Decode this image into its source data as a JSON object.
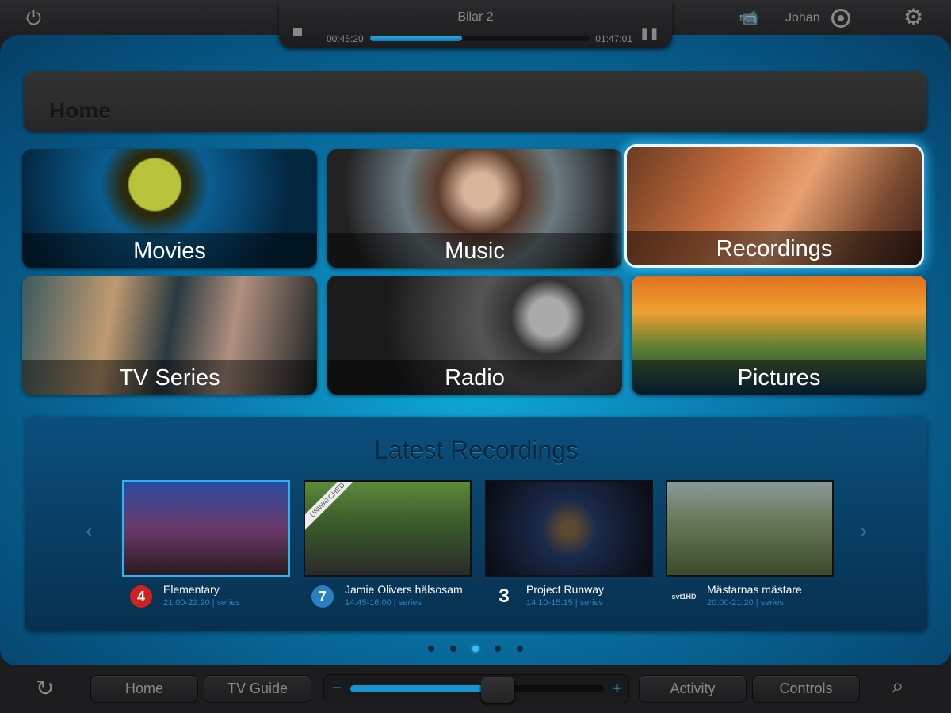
{
  "top": {
    "user": "Johan",
    "icons": [
      "power-icon",
      "camera-icon",
      "target-icon",
      "gear-icon"
    ]
  },
  "now_playing": {
    "title": "Bilar 2",
    "elapsed": "00:45:20",
    "total": "01:47:01",
    "progress_percent": 42
  },
  "header": {
    "title": "Home"
  },
  "tiles": [
    {
      "label": "Movies",
      "selected": false
    },
    {
      "label": "Music",
      "selected": false
    },
    {
      "label": "Recordings",
      "selected": true
    },
    {
      "label": "TV Series",
      "selected": false
    },
    {
      "label": "Radio",
      "selected": false
    },
    {
      "label": "Pictures",
      "selected": false
    }
  ],
  "latest": {
    "title": "Latest Recordings",
    "items": [
      {
        "title": "Elementary",
        "time": "21:00-22:20",
        "type": "series",
        "channel": "4",
        "selected": true
      },
      {
        "title": "Jamie Olivers hälsosam",
        "time": "14:45-16:00",
        "type": "series",
        "channel": "7",
        "badge": "UNWATCHED"
      },
      {
        "title": "Project Runway",
        "time": "14:10-15:15",
        "type": "series",
        "channel": "3"
      },
      {
        "title": "Mästarnas mästare",
        "time": "20:00-21:20",
        "type": "series",
        "channel": "svt1HD"
      }
    ],
    "page_count": 5,
    "active_page": 3
  },
  "bottom": {
    "home": "Home",
    "tv_guide": "TV Guide",
    "activity": "Activity",
    "controls": "Controls",
    "volume_percent": 58
  },
  "colors": {
    "accent": "#2ab4f0"
  }
}
